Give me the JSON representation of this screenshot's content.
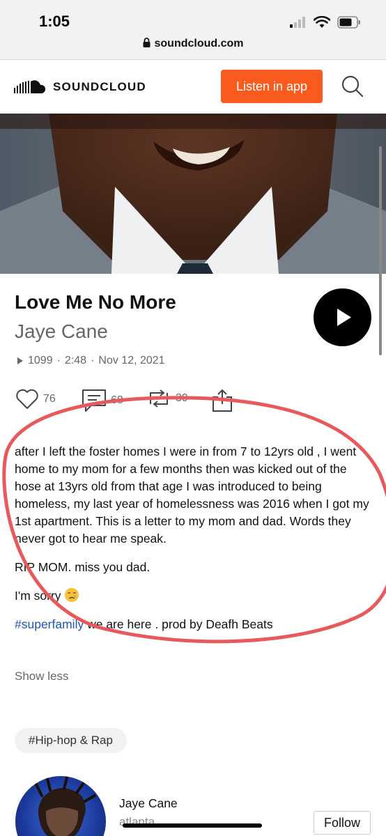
{
  "status_bar": {
    "time": "1:05"
  },
  "browser": {
    "url": "soundcloud.com"
  },
  "header": {
    "logo_text": "SOUNDCLOUD",
    "listen_button": "Listen in app"
  },
  "track": {
    "title": "Love Me No More",
    "artist": "Jaye Cane",
    "plays": "1099",
    "duration": "2:48",
    "date": "Nov 12, 2021",
    "separator": "·"
  },
  "actions": {
    "likes": "76",
    "comments": "68",
    "reposts": "39"
  },
  "description": {
    "paragraph1": "after I left the foster homes I were in from 7 to 12yrs old , I went home to my mom for a few months then was kicked out of the hose at 13yrs old from that age I was introduced to being homeless, my last year of homelessness was 2016 when I got my 1st apartment. This is a letter to my mom and dad. Words they never got to hear me speak.",
    "paragraph2": "RIP MOM. miss you dad.",
    "paragraph3": "I'm sorry",
    "hashtag": "#superfamily",
    "paragraph4_rest": " we are here . prod by Deafh Beats"
  },
  "show_less": "Show less",
  "genre_tag": "#Hip-hop & Rap",
  "user": {
    "name": "Jaye Cane",
    "location": "atlanta",
    "follow_button": "Follow"
  },
  "colors": {
    "brand_orange": "#f85b1d",
    "link_blue": "#1f56b8",
    "annotation_red": "#e8595b"
  }
}
